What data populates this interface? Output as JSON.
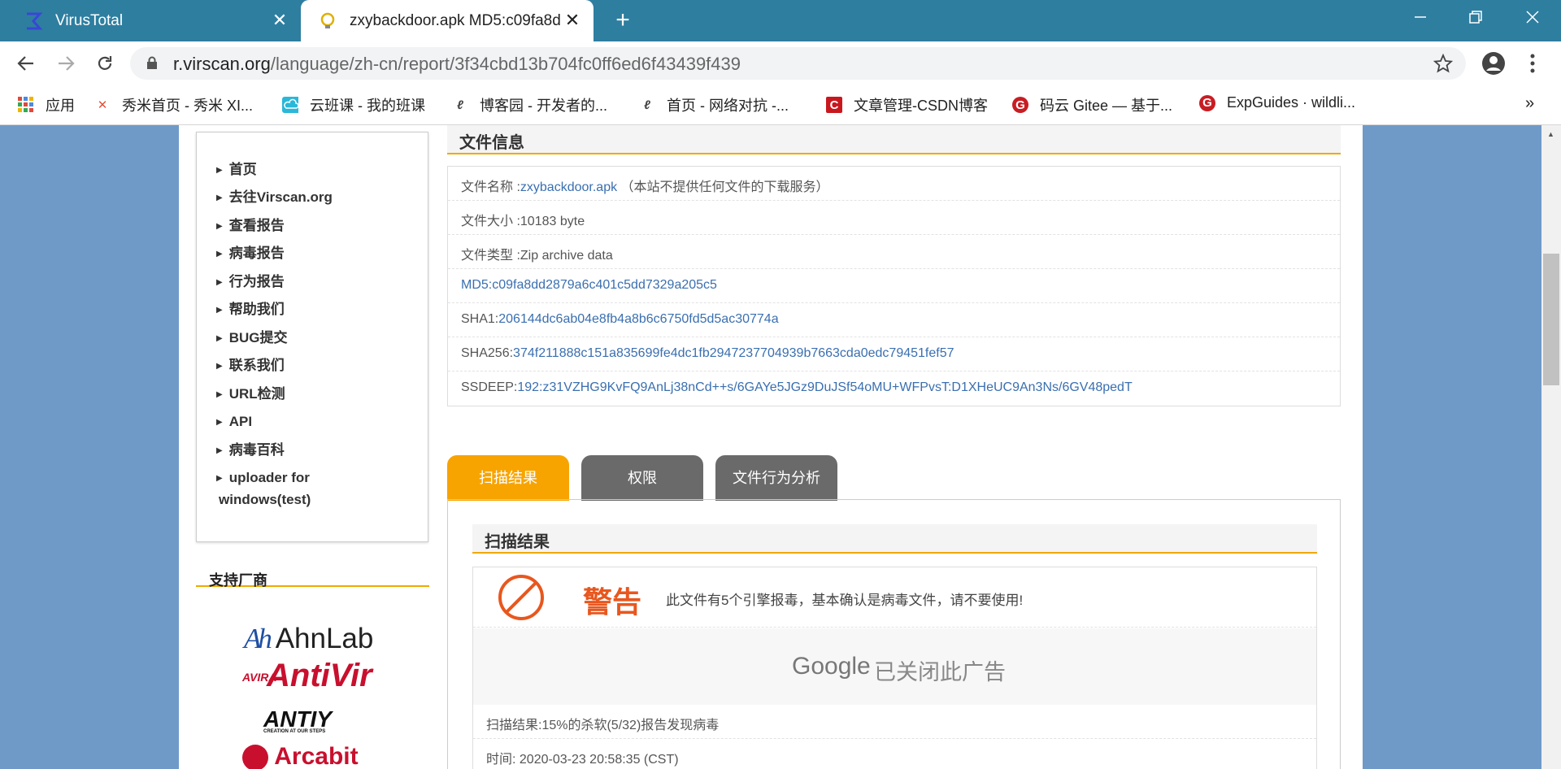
{
  "browser": {
    "tabs": [
      {
        "title": "VirusTotal",
        "icon": "sigma-icon"
      },
      {
        "title": "zxybackdoor.apk MD5:c09fa8d",
        "icon": "lightbulb-icon"
      }
    ],
    "url_host": "r.virscan.org",
    "url_path": "/language/zh-cn/report/3f34cbd13b704fc0ff6ed6f43439f439",
    "bookmarks": [
      {
        "label": "应用",
        "icon": "apps-grid-icon"
      },
      {
        "label": "秀米首页 - 秀米 XI...",
        "icon": "xiumi-icon"
      },
      {
        "label": "云班课 - 我的班课",
        "icon": "cloud-icon"
      },
      {
        "label": "博客园 - 开发者的...",
        "icon": "cnblogs-icon"
      },
      {
        "label": "首页 - 网络对抗 -...",
        "icon": "cnblogs-icon"
      },
      {
        "label": "文章管理-CSDN博客",
        "icon": "csdn-icon"
      },
      {
        "label": "码云 Gitee — 基于...",
        "icon": "gitee-icon"
      },
      {
        "label": "ExpGuides · wildli...",
        "icon": "gitee-icon"
      }
    ],
    "overflow": "»"
  },
  "sidebar": {
    "items": [
      "首页",
      "去往Virscan.org",
      "查看报告",
      "病毒报告",
      "行为报告",
      "帮助我们",
      "BUG提交",
      "联系我们",
      "URL检测",
      "API",
      "病毒百科",
      "uploader for",
      "windows(test)"
    ],
    "vendors_title": "支持厂商",
    "vendor_logos": [
      "AhnLab",
      "AntiVir",
      "ANTIY",
      "Arcabit"
    ],
    "vendor_sublabels": {
      "avira": "AVIRA",
      "antiy": "CREATION AT OUR STEPS"
    }
  },
  "fileinfo": {
    "title": "文件信息",
    "name_label": "文件名称 :",
    "name_value": "zxybackdoor.apk",
    "name_note": "（本站不提供任何文件的下载服务）",
    "size_label": "文件大小 :",
    "size_value": "10183 byte",
    "type_label": "文件类型 :",
    "type_value": "Zip archive data",
    "md5_label": "MD5:",
    "md5_value": "c09fa8dd2879a6c401c5dd7329a205c5",
    "sha1_label": "SHA1:",
    "sha1_value": "206144dc6ab04e8fb4a8b6c6750fd5d5ac30774a",
    "sha256_label": "SHA256:",
    "sha256_value": "374f211888c151a835699fe4dc1fb2947237704939b7663cda0edc79451fef57",
    "ssdeep_label": "SSDEEP:",
    "ssdeep_value": "192:z31VZHG9KvFQ9AnLj38nCd++s/6GAYe5JGz9DuJSf54oMU+WFPvsT:D1XHeUC9An3Ns/6GV48pedT"
  },
  "tabs": {
    "scan": "扫描结果",
    "perm": "权限",
    "behavior": "文件行为分析"
  },
  "scan": {
    "title": "扫描结果",
    "warn_title": "警告",
    "warn_text": "此文件有5个引擎报毒，基本确认是病毒文件，请不要使用!",
    "ad_brand": "Google",
    "ad_text": "已关闭此广告",
    "result": "扫描结果:15%的杀软(5/32)报告发现病毒",
    "time": "时间: 2020-03-23 20:58:35 (CST)"
  },
  "colors": {
    "tabbar": "#2e7ea0",
    "accent": "#f0a900",
    "active_tab": "#f7a400",
    "inactive_tab": "#6a6a6a",
    "warn": "#e8571e",
    "link": "#3a6fb0",
    "bg": "#6f9ac8"
  }
}
